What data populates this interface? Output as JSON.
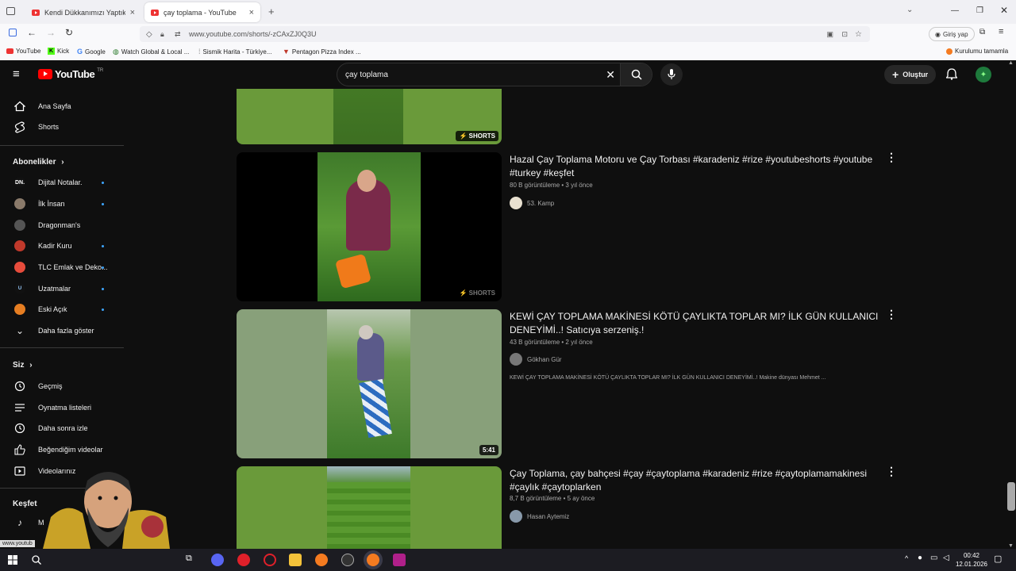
{
  "browser": {
    "tabs": [
      {
        "title": "Kendi Dükkanımızı Yaptık | Hara",
        "close": "×"
      },
      {
        "title": "çay toplama - YouTube",
        "close": "×"
      }
    ],
    "new_tab": "+",
    "url": "www.youtube.com/shorts/-zCAxZJ0Q3U",
    "login": "Giriş yap",
    "bookmarks": [
      "YouTube",
      "Kick",
      "Google",
      "Watch Global & Local ...",
      "Sismik Harita - Türkiye...",
      "Pentagon Pizza Index ..."
    ],
    "bookmarks_right": "Kurulumu tamamla"
  },
  "header": {
    "logo": "YouTube",
    "logo_region": "TR",
    "search_value": "çay toplama",
    "create_label": "Oluştur"
  },
  "sidebar": {
    "main": [
      {
        "label": "Ana Sayfa",
        "icon": "home-icon"
      },
      {
        "label": "Shorts",
        "icon": "shorts-icon"
      }
    ],
    "subs_heading": "Abonelikler",
    "subs": [
      {
        "label": "Dijital Notalar.",
        "avatar": "DN.",
        "color": "#1a1a1a",
        "dot": true
      },
      {
        "label": "İlk İnsan",
        "avatar": "",
        "color": "#8a7a6a",
        "dot": true
      },
      {
        "label": "Dragonman's",
        "avatar": "",
        "color": "#555555",
        "dot": false
      },
      {
        "label": "Kadir Kuru",
        "avatar": "",
        "color": "#c0392b",
        "dot": true
      },
      {
        "label": "TLC Emlak ve Deko...",
        "avatar": "",
        "color": "#e74c3c",
        "dot": true
      },
      {
        "label": "Uzatmalar",
        "avatar": "U",
        "color": "#1a1a1a",
        "dot": true
      },
      {
        "label": "Eski Açık",
        "avatar": "",
        "color": "#e67e22",
        "dot": true
      }
    ],
    "more_label": "Daha fazla göster",
    "you_heading": "Siz",
    "you": [
      {
        "label": "Geçmiş",
        "icon": "history-icon"
      },
      {
        "label": "Oynatma listeleri",
        "icon": "playlist-icon"
      },
      {
        "label": "Daha sonra izle",
        "icon": "clock-icon"
      },
      {
        "label": "Beğendiğim videolar",
        "icon": "like-icon"
      },
      {
        "label": "Videolarınız",
        "icon": "video-icon"
      }
    ],
    "explore_heading": "Keşfet",
    "explore_first": "M",
    "status_url": "www.youtub"
  },
  "results": [
    {
      "badge": "SHORTS",
      "title": "",
      "meta": "",
      "channel": "",
      "desc": ""
    },
    {
      "badge": "SHORTS",
      "title": "Hazal Çay Toplama Motoru ve Çay Torbası #karadeniz #rize #youtubeshorts #youtube #turkey #keşfet",
      "meta": "80 B görüntüleme • 3 yıl önce",
      "channel": "53. Kamp",
      "desc": ""
    },
    {
      "badge": "5:41",
      "title": "KEWİ ÇAY TOPLAMA MAKİNESİ KÖTÜ ÇAYLIKTA TOPLAR MI? İLK GÜN KULLANICI DENEYİMİ..! Satıcıya serzeniş.!",
      "meta": "43 B görüntüleme • 2 yıl önce",
      "channel": "Gökhan Gür",
      "desc": "KEWİ ÇAY TOPLAMA MAKİNESİ KÖTÜ ÇAYLIKTA TOPLAR MI? İLK GÜN KULLANICI DENEYİMİ..! Makine dünyası Mehmet ..."
    },
    {
      "badge": "",
      "title": "Çay Toplama, çay bahçesi #çay #çaytoplama #karadeniz #rize #çaytoplamamakinesi #çaylık #çaytoplarken",
      "meta": "8,7 B görüntüleme • 5 ay önce",
      "channel": "Hasan Aytemiz",
      "desc": ""
    }
  ],
  "taskbar": {
    "time": "00:42",
    "date": "12.01.2026"
  }
}
